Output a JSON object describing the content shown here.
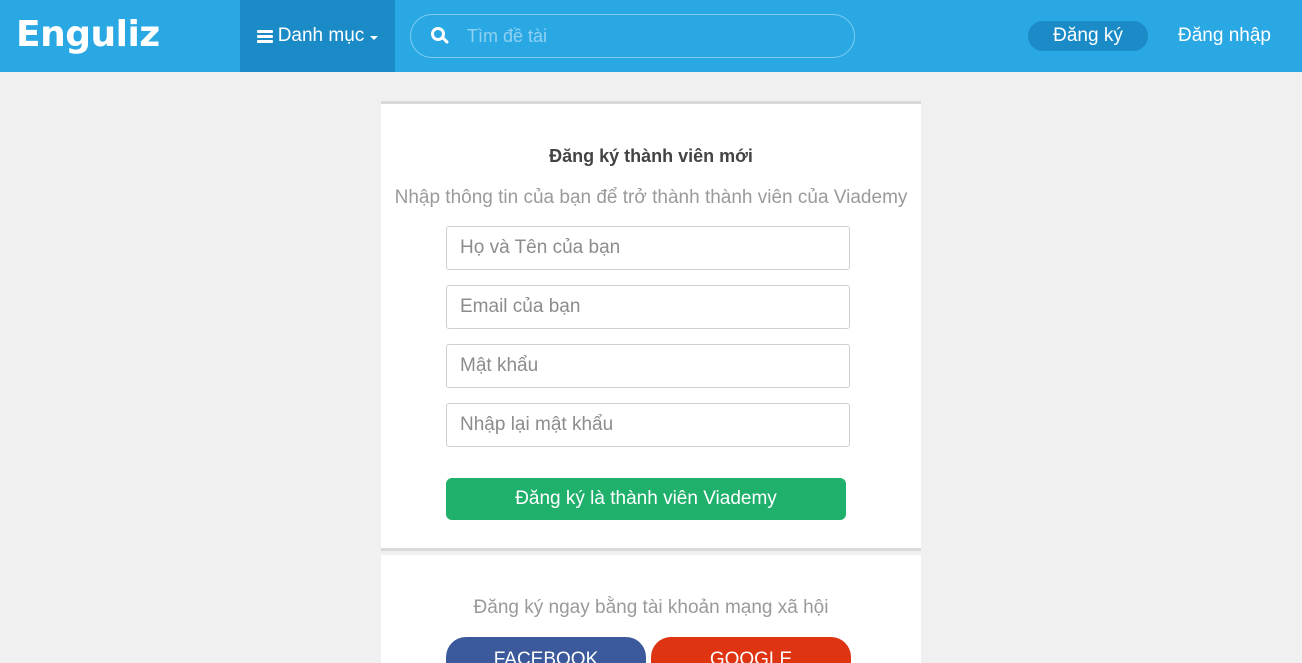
{
  "header": {
    "logo": "Enguliz",
    "category_label": "Danh mục",
    "search_placeholder": "Tìm đề tài",
    "register_label": "Đăng ký",
    "login_label": "Đăng nhập"
  },
  "form": {
    "title": "Đăng ký thành viên mới",
    "subtitle": "Nhập thông tin của bạn để trở thành thành viên của Viademy",
    "fullname_placeholder": "Họ và Tên của bạn",
    "email_placeholder": "Email của bạn",
    "password_placeholder": "Mật khẩu",
    "password_confirm_placeholder": "Nhập lại mật khẩu",
    "submit_label": "Đăng ký là thành viên Viademy"
  },
  "social": {
    "prompt": "Đăng ký ngay bằng tài khoản mạng xã hội",
    "facebook_label": "FACEBOOK",
    "google_label": "GOOGLE"
  },
  "colors": {
    "header_bg": "#29a8e4",
    "header_dark": "#1a8bc6",
    "submit_green": "#1fb06b",
    "facebook_blue": "#3c5a9b",
    "google_red": "#de3412"
  }
}
